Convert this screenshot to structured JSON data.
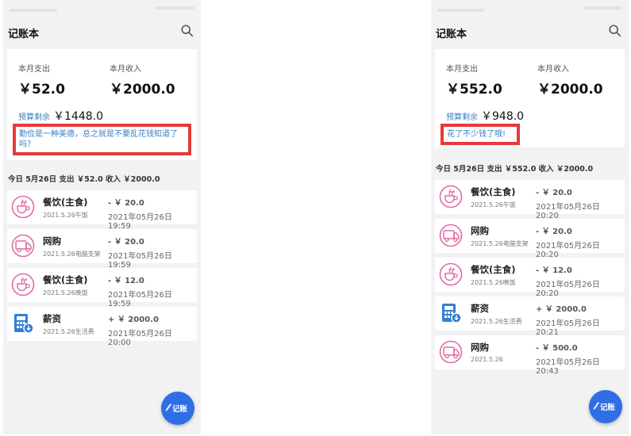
{
  "colors": {
    "accent": "#2f6fe6",
    "highlight_border": "#e5393b",
    "budget_label": "#3a7fc2",
    "icon_pink": "#e36aa8",
    "icon_blue": "#2f7fd6"
  },
  "screens": [
    {
      "title": "记账本",
      "summary": {
        "expense_label": "本月支出",
        "income_label": "本月收入",
        "expense": "￥52.0",
        "income": "￥2000.0",
        "budget_label": "预算剩余",
        "budget_value": "￥1448.0",
        "tip": "勤俭是一种美德，总之就是不要乱花钱知道了吗？"
      },
      "today": "今日 5月26日 支出 ￥52.0 收入 ￥2000.0",
      "records": [
        {
          "icon": "dining-icon",
          "category": "餐饮(主食)",
          "note": "2021.5.26午饭",
          "amount": "- ￥ 20.0",
          "time": "2021年05月26日 19:59"
        },
        {
          "icon": "shopping-truck-icon",
          "category": "网购",
          "note": "2021.5.26电脑支架",
          "amount": "- ￥ 20.0",
          "time": "2021年05月26日 19:59"
        },
        {
          "icon": "dining-icon",
          "category": "餐饮(主食)",
          "note": "2021.5.26晚饭",
          "amount": "- ￥ 12.0",
          "time": "2021年05月26日 19:59"
        },
        {
          "icon": "salary-calculator-icon",
          "category": "薪资",
          "note": "2021.5.26生活费",
          "amount": "+ ￥ 2000.0",
          "time": "2021年05月26日 20:00"
        }
      ],
      "fab_label": "记账"
    },
    {
      "title": "记账本",
      "summary": {
        "expense_label": "本月支出",
        "income_label": "本月收入",
        "expense": "￥552.0",
        "income": "￥2000.0",
        "budget_label": "预算剩余",
        "budget_value": "￥948.0",
        "tip": "花了不少钱了哦!"
      },
      "today": "今日 5月26日 支出 ￥552.0 收入 ￥2000.0",
      "records": [
        {
          "icon": "dining-icon",
          "category": "餐饮(主食)",
          "note": "2021.5.26午饭",
          "amount": "- ￥ 20.0",
          "time": "2021年05月26日 20:20"
        },
        {
          "icon": "shopping-truck-icon",
          "category": "网购",
          "note": "2021.5.26电脑支架",
          "amount": "- ￥ 20.0",
          "time": "2021年05月26日 20:20"
        },
        {
          "icon": "dining-icon",
          "category": "餐饮(主食)",
          "note": "2021.5.26晚饭",
          "amount": "- ￥ 12.0",
          "time": "2021年05月26日 20:20"
        },
        {
          "icon": "salary-calculator-icon",
          "category": "薪资",
          "note": "2021.5.26生活费",
          "amount": "+ ￥ 2000.0",
          "time": "2021年05月26日 20:21"
        },
        {
          "icon": "shopping-truck-icon",
          "category": "网购",
          "note": "2021.5.26",
          "amount": "- ￥ 500.0",
          "time": "2021年05月26日 20:43"
        }
      ],
      "fab_label": "记账"
    }
  ]
}
